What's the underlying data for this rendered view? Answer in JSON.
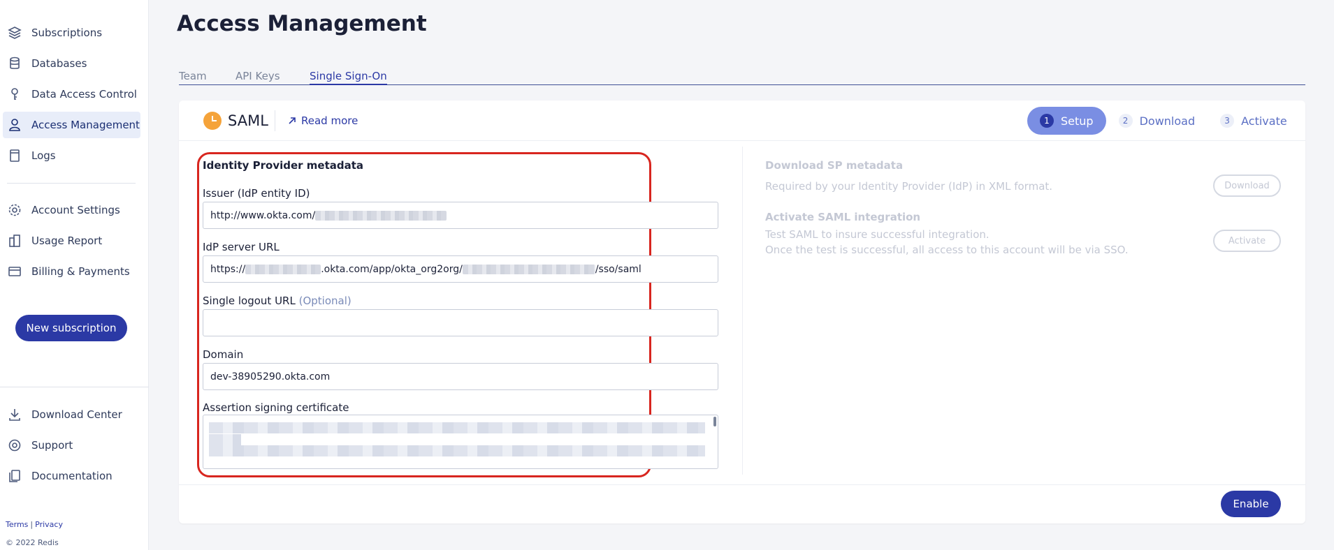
{
  "sidebar": {
    "items": [
      {
        "label": "Subscriptions",
        "icon": "layers-icon"
      },
      {
        "label": "Databases",
        "icon": "database-icon"
      },
      {
        "label": "Data Access Control",
        "icon": "key-icon"
      },
      {
        "label": "Access Management",
        "icon": "user-icon"
      },
      {
        "label": "Logs",
        "icon": "document-icon"
      },
      {
        "label": "Account Settings",
        "icon": "gear-icon"
      },
      {
        "label": "Usage Report",
        "icon": "report-icon"
      },
      {
        "label": "Billing & Payments",
        "icon": "card-icon"
      }
    ],
    "new_subscription": "New subscription",
    "bottom_items": [
      {
        "label": "Download Center",
        "icon": "download-icon"
      },
      {
        "label": "Support",
        "icon": "lifebuoy-icon"
      },
      {
        "label": "Documentation",
        "icon": "docs-icon"
      }
    ],
    "terms": "Terms",
    "privacy": "Privacy",
    "copyright": "© 2022 Redis"
  },
  "page": {
    "title": "Access Management",
    "tabs": [
      {
        "label": "Team"
      },
      {
        "label": "API Keys"
      },
      {
        "label": "Single Sign-On",
        "active": true
      }
    ]
  },
  "saml": {
    "title": "SAML",
    "read_more": "Read more",
    "steps": [
      {
        "num": "1",
        "label": "Setup",
        "active": true
      },
      {
        "num": "2",
        "label": "Download"
      },
      {
        "num": "3",
        "label": "Activate"
      }
    ],
    "form": {
      "section_title": "Identity Provider metadata",
      "issuer_label": "Issuer (IdP entity ID)",
      "issuer_value_prefix": "http://www.okta.com/",
      "server_label": "IdP server URL",
      "server_value_prefix": "https://",
      "server_value_middle": ".okta.com/app/okta_org2org/",
      "server_value_suffix": "/sso/saml",
      "logout_label": "Single logout URL",
      "logout_optional": "(Optional)",
      "logout_value": "",
      "domain_label": "Domain",
      "domain_value": "dev-38905290.okta.com",
      "cert_label": "Assertion signing certificate"
    },
    "right": {
      "download_title": "Download SP metadata",
      "download_text": "Required by your Identity Provider (IdP) in XML format.",
      "download_button": "Download",
      "activate_title": "Activate SAML integration",
      "activate_text_1": "Test SAML to insure successful integration.",
      "activate_text_2": "Once the test is successful, all access to this account will be via SSO.",
      "activate_button": "Activate"
    },
    "enable_button": "Enable"
  },
  "colors": {
    "accent": "#2b39a5",
    "highlight_box": "#d8261f",
    "saml_icon": "#f5a33a"
  }
}
